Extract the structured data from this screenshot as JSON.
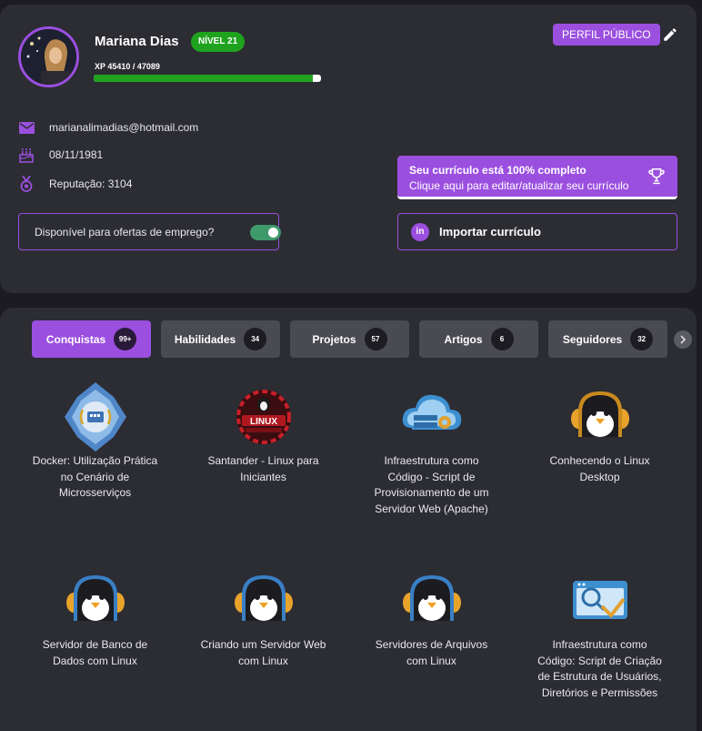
{
  "profile": {
    "name": "Mariana Dias",
    "level": "NÍVEL 21",
    "xp_label": "XP 45410 / 47089",
    "xp_progress": 0.964,
    "public_button": "PERFIL PÚBLICO",
    "email": "marianalimadias@hotmail.com",
    "birthdate": "08/11/1981",
    "reputation": "Reputação: 3104",
    "job_offers_label": "Disponível para ofertas de emprego?",
    "job_offers_enabled": true,
    "cv_title": "Seu currículo está 100% completo",
    "cv_subtitle": "Clique aqui para editar/atualizar seu currículo",
    "import_cv_label": "Importar currículo",
    "import_icon_text": "in"
  },
  "colors": {
    "accent": "#9b4fdf",
    "level_green": "#1fa31f",
    "toggle_green": "#3e9a6b",
    "card_bg": "#2c2c33",
    "page_bg": "#1b1b21"
  },
  "tabs": [
    {
      "label": "Conquistas",
      "count": "99+",
      "active": true
    },
    {
      "label": "Habilidades",
      "count": "34",
      "active": false
    },
    {
      "label": "Projetos",
      "count": "57",
      "active": false
    },
    {
      "label": "Artigos",
      "count": "6",
      "active": false
    },
    {
      "label": "Seguidores",
      "count": "32",
      "active": false
    }
  ],
  "badges": [
    {
      "label": "Docker: Utilização Prática no Cenário de Microsserviços",
      "icon": "docker-badge-icon"
    },
    {
      "label": "Santander - Linux para Iniciantes",
      "icon": "linux-iniciantes-badge-icon"
    },
    {
      "label": "Infraestrutura como Código - Script de Provisionamento de um Servidor Web (Apache)",
      "icon": "cloud-server-badge-icon"
    },
    {
      "label": "Conhecendo o Linux Desktop",
      "icon": "penguin-gold-badge-icon"
    },
    {
      "label": "Servidor de Banco de Dados com Linux",
      "icon": "penguin-badge-icon"
    },
    {
      "label": "Criando um Servidor Web com Linux",
      "icon": "penguin-badge-icon"
    },
    {
      "label": "Servidores de Arquivos com Linux",
      "icon": "penguin-badge-icon"
    },
    {
      "label": "Infraestrutura como Código: Script de Criação de Estrutura de Usuários, Diretórios e Permissões",
      "icon": "browser-check-badge-icon"
    }
  ]
}
